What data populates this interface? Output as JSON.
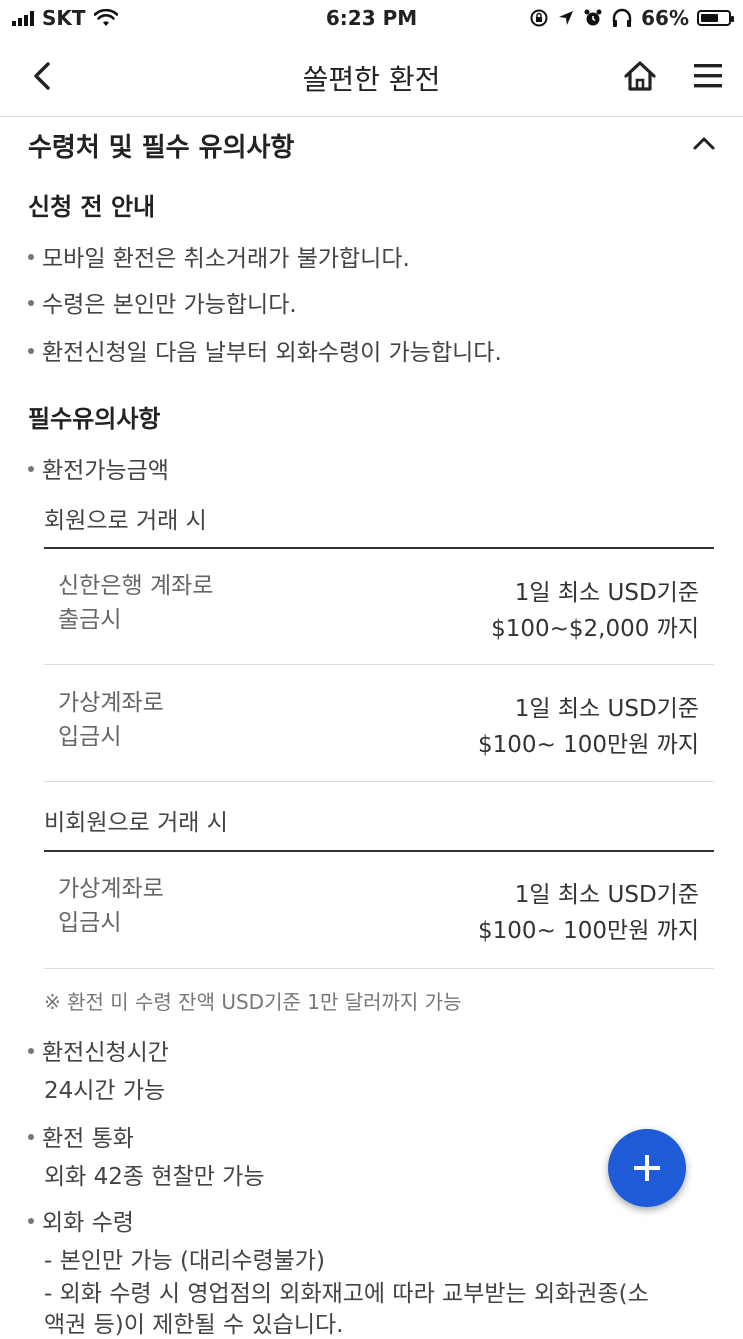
{
  "status_bar": {
    "carrier": "SKT",
    "time": "6:23 PM",
    "battery_percent": "66%",
    "battery_level": 0.66
  },
  "nav": {
    "title": "쏠편한 환전",
    "back_icon": "chevron-left-icon",
    "home_icon": "home-icon",
    "menu_icon": "hamburger-menu-icon"
  },
  "section": {
    "title": "수령처 및 필수 유의사항",
    "toggle_icon": "chevron-up-icon"
  },
  "before_apply": {
    "heading": "신청 전 안내",
    "items": [
      "모바일 환전은 취소거래가 불가합니다.",
      "수령은 본인만 가능합니다.",
      "환전신청일 다음 날부터 외화수령이 가능합니다."
    ]
  },
  "required": {
    "heading": "필수유의사항",
    "amount_label": "환전가능금액",
    "member_label": "회원으로 거래 시",
    "member_rows": [
      {
        "left1": "신한은행 계좌로",
        "left2": "출금시",
        "right1": "1일 최소 USD기준",
        "right2": "$100~$2,000 까지"
      },
      {
        "left1": "가상계좌로",
        "left2": "입금시",
        "right1": "1일 최소 USD기준",
        "right2": "$100~ 100만원 까지"
      }
    ],
    "nonmember_label": "비회원으로 거래 시",
    "nonmember_rows": [
      {
        "left1": "가상계좌로",
        "left2": "입금시",
        "right1": "1일 최소 USD기준",
        "right2": "$100~ 100만원 까지"
      }
    ],
    "note": "※ 환전 미 수령 잔액 USD기준 1만 달러까지 가능",
    "apply_time_label": "환전신청시간",
    "apply_time_value": "24시간 가능",
    "currency_label": "환전 통화",
    "currency_value": "외화 42종 현찰만 가능",
    "receive_label": "외화 수령",
    "receive_line1": "- 본인만 가능 (대리수령불가)",
    "receive_line2": "- 외화 수령 시 영업점의 외화재고에 따라 교부받는 외화권종(소",
    "receive_line3": "액권 등)이 제한될 수 있습니다."
  },
  "fab": {
    "icon": "plus-icon",
    "color": "#1f5bd6"
  }
}
